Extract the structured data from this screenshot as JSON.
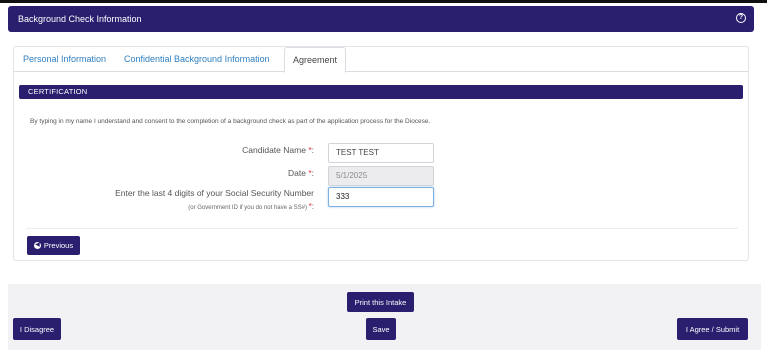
{
  "header": {
    "title": "Background Check Information",
    "help_icon": "?"
  },
  "tabs": [
    {
      "label": "Personal Information"
    },
    {
      "label": "Confidential Background Information"
    },
    {
      "label": "Agreement"
    }
  ],
  "certification": {
    "title": "CERTIFICATION",
    "consent_text": "By typing in my name I understand and consent to the completion of a background check as part of the application process for the Diocese."
  },
  "form": {
    "candidate_name_label": "Candidate Name",
    "candidate_name_value": "TEST TEST",
    "date_label": "Date",
    "date_value": "5/1/2025",
    "ssn_label": "Enter the last 4 digits of your Social Security Number",
    "ssn_sublabel": "(or Government ID if you do not have a SS#)",
    "ssn_value": "333",
    "required_marker": "*",
    "colon": ":"
  },
  "buttons": {
    "previous": "Previous",
    "print": "Print this Intake",
    "disagree": "I Disagree",
    "save": "Save",
    "agree": "I Agree / Submit"
  },
  "colors": {
    "primary": "#2a1f6e",
    "tab_link": "#2e7fc0",
    "required": "#e0312b"
  }
}
